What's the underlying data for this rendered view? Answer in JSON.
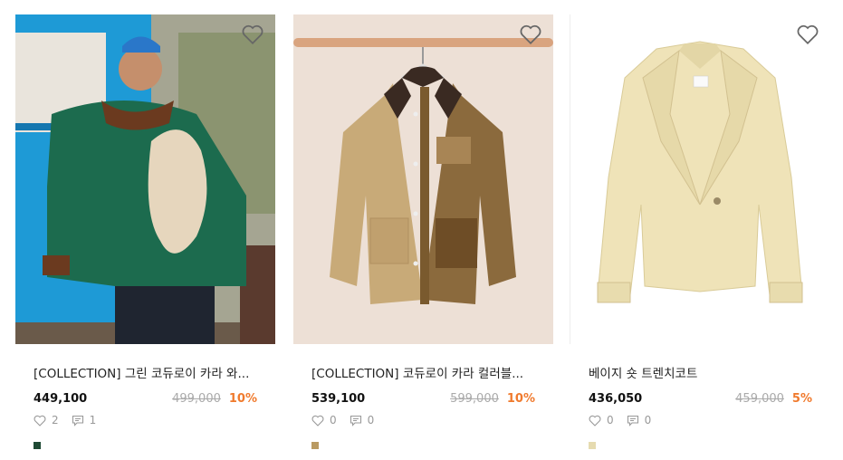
{
  "products": [
    {
      "title": "[COLLECTION] 그린 코듀로이 카라 와...",
      "sale_price": "449,100",
      "original_price": "499,000",
      "discount": "10%",
      "likes": "2",
      "reviews": "1",
      "swatch_color": "#1f4a34",
      "icons": [
        "heart-icon",
        "heart-outline-icon",
        "comment-icon"
      ]
    },
    {
      "title": "[COLLECTION] 코듀로이 카라 컬러블...",
      "sale_price": "539,100",
      "original_price": "599,000",
      "discount": "10%",
      "likes": "0",
      "reviews": "0",
      "swatch_color": "#b99a62",
      "icons": [
        "heart-icon",
        "heart-outline-icon",
        "comment-icon"
      ]
    },
    {
      "title": "베이지 숏 트렌치코트",
      "sale_price": "436,050",
      "original_price": "459,000",
      "discount": "5%",
      "likes": "0",
      "reviews": "0",
      "swatch_color": "#e6dbb0",
      "icons": [
        "heart-icon",
        "heart-outline-icon",
        "comment-icon"
      ]
    }
  ],
  "colors": {
    "discount": "#f07a2d",
    "strikethrough": "#aaaaaa"
  }
}
